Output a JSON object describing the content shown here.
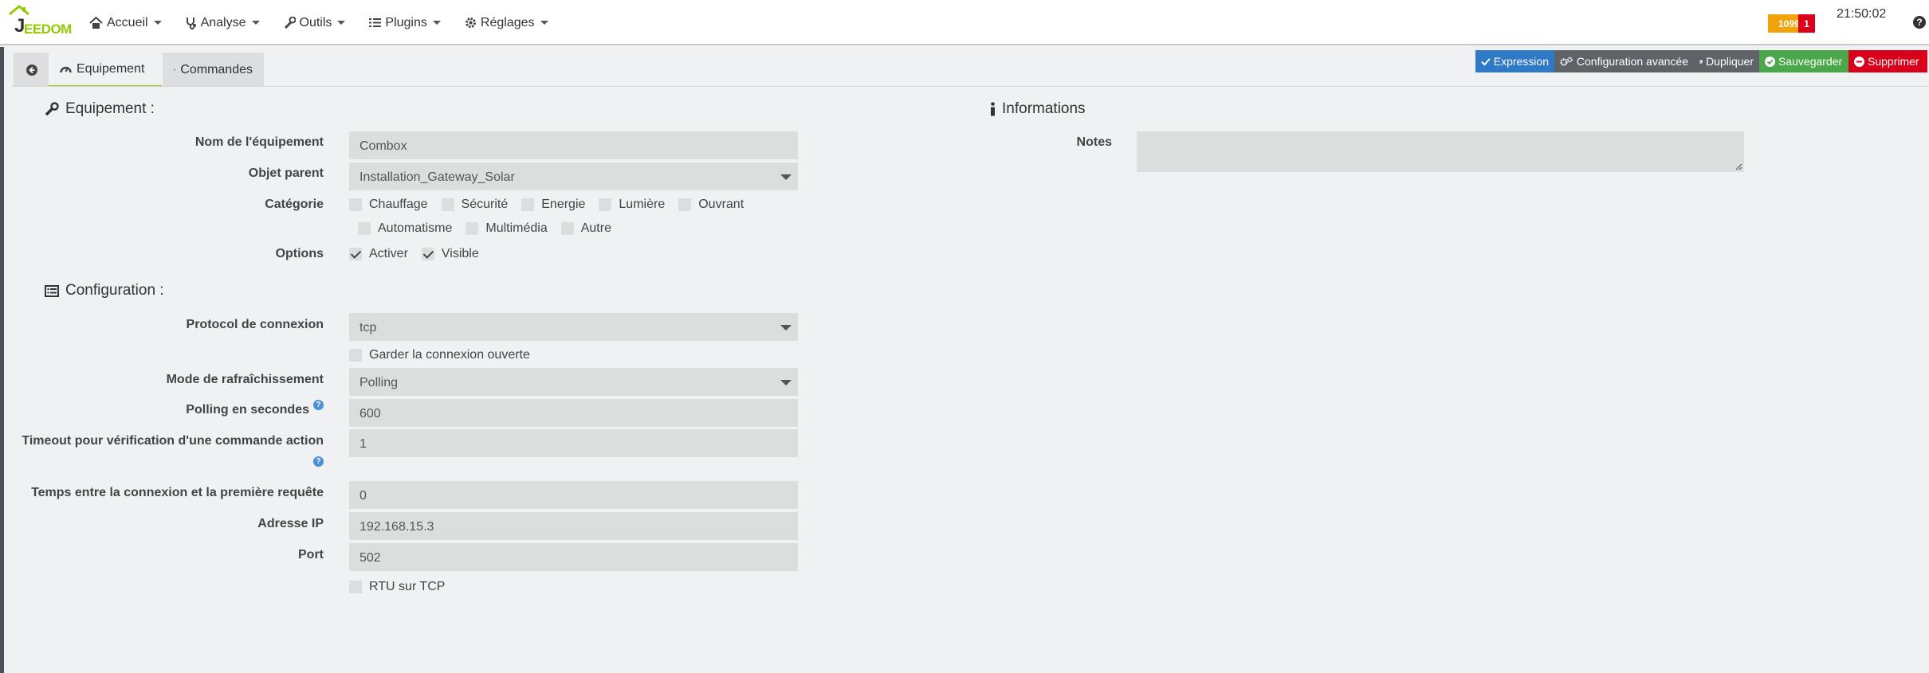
{
  "navbar": {
    "logo_letter": "J",
    "logo_text": "EEDOM",
    "menu": [
      {
        "label": "Accueil",
        "icon": "home-icon"
      },
      {
        "label": "Analyse",
        "icon": "stethoscope-icon"
      },
      {
        "label": "Outils",
        "icon": "wrench-icon"
      },
      {
        "label": "Plugins",
        "icon": "list-icon"
      },
      {
        "label": "Réglages",
        "icon": "gear-icon"
      }
    ],
    "badge_warning": "1099",
    "badge_alert": "1",
    "clock": "21:50:02",
    "help": "?"
  },
  "tabs": {
    "items": [
      {
        "label": "Equipement",
        "icon": "dashboard-icon"
      },
      {
        "label": "Commandes",
        "icon": "list-alt-icon"
      }
    ],
    "active": "Equipement"
  },
  "actions": {
    "expression": "Expression",
    "advanced": "Configuration avancée",
    "duplicate": "Dupliquer",
    "save": "Sauvegarder",
    "delete": "Supprimer"
  },
  "equipement": {
    "title": "Equipement :",
    "name_label": "Nom de l'équipement",
    "name_value": "Combox",
    "parent_label": "Objet parent",
    "parent_value": "Installation_Gateway_Solar",
    "category_label": "Catégorie",
    "categories": [
      {
        "label": "Chauffage",
        "checked": false
      },
      {
        "label": "Sécurité",
        "checked": false
      },
      {
        "label": "Energie",
        "checked": false
      },
      {
        "label": "Lumière",
        "checked": false
      },
      {
        "label": "Ouvrant",
        "checked": false
      },
      {
        "label": "Automatisme",
        "checked": false
      },
      {
        "label": "Multimédia",
        "checked": false
      },
      {
        "label": "Autre",
        "checked": false
      }
    ],
    "options_label": "Options",
    "options": [
      {
        "label": "Activer",
        "checked": true
      },
      {
        "label": "Visible",
        "checked": true
      }
    ]
  },
  "configuration": {
    "title": "Configuration :",
    "protocol_label": "Protocol de connexion",
    "protocol_value": "tcp",
    "keep_open_label": "Garder la connexion ouverte",
    "refresh_label": "Mode de rafraîchissement",
    "refresh_value": "Polling",
    "polling_label": "Polling en secondes",
    "polling_value": "600",
    "timeout_label_line1": "Timeout pour vérification d'une commande action",
    "timeout_value": "1",
    "delay_label": "Temps entre la connexion et la première requête",
    "delay_value": "0",
    "ip_label": "Adresse IP",
    "ip_value": "192.168.15.3",
    "port_label": "Port",
    "port_value": "502",
    "rtu_label": "RTU sur TCP"
  },
  "informations": {
    "title": "Informations",
    "notes_label": "Notes",
    "notes_value": ""
  }
}
